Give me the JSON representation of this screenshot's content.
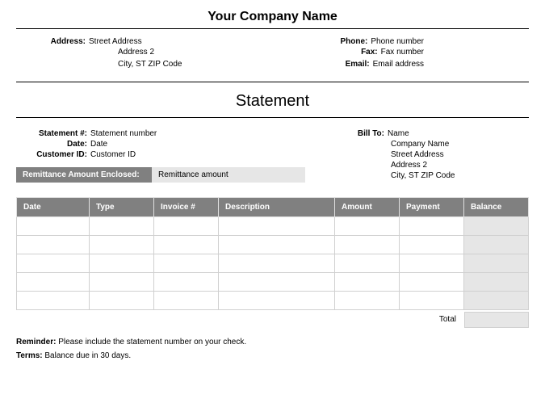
{
  "company": {
    "name": "Your Company Name",
    "address_label": "Address:",
    "address_line1": "Street Address",
    "address_line2": "Address 2",
    "address_line3": "City, ST  ZIP Code",
    "phone_label": "Phone:",
    "phone": "Phone number",
    "fax_label": "Fax:",
    "fax": "Fax number",
    "email_label": "Email:",
    "email": "Email address"
  },
  "title": "Statement",
  "statement": {
    "number_label": "Statement #:",
    "number": "Statement number",
    "date_label": "Date:",
    "date": "Date",
    "customer_id_label": "Customer ID:",
    "customer_id": "Customer ID"
  },
  "bill_to": {
    "label": "Bill To:",
    "name": "Name",
    "company": "Company Name",
    "address_line1": "Street Address",
    "address_line2": "Address 2",
    "address_line3": "City, ST  ZIP Code"
  },
  "remittance": {
    "label": "Remittance Amount Enclosed:",
    "value": "Remittance amount"
  },
  "table": {
    "headers": {
      "date": "Date",
      "type": "Type",
      "invoice": "Invoice #",
      "description": "Description",
      "amount": "Amount",
      "payment": "Payment",
      "balance": "Balance"
    },
    "total_label": "Total"
  },
  "footer": {
    "reminder_label": "Reminder:",
    "reminder_text": " Please include the statement number on your check.",
    "terms_label": "Terms:",
    "terms_text": " Balance due in 30 days."
  }
}
